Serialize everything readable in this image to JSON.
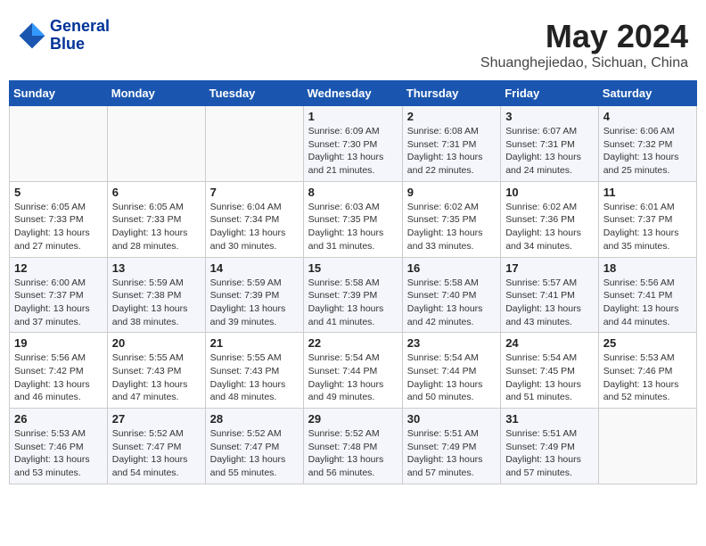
{
  "header": {
    "logo_line1": "General",
    "logo_line2": "Blue",
    "title": "May 2024",
    "subtitle": "Shuanghejiedao, Sichuan, China"
  },
  "weekdays": [
    "Sunday",
    "Monday",
    "Tuesday",
    "Wednesday",
    "Thursday",
    "Friday",
    "Saturday"
  ],
  "weeks": [
    [
      {
        "day": "",
        "info": ""
      },
      {
        "day": "",
        "info": ""
      },
      {
        "day": "",
        "info": ""
      },
      {
        "day": "1",
        "info": "Sunrise: 6:09 AM\nSunset: 7:30 PM\nDaylight: 13 hours\nand 21 minutes."
      },
      {
        "day": "2",
        "info": "Sunrise: 6:08 AM\nSunset: 7:31 PM\nDaylight: 13 hours\nand 22 minutes."
      },
      {
        "day": "3",
        "info": "Sunrise: 6:07 AM\nSunset: 7:31 PM\nDaylight: 13 hours\nand 24 minutes."
      },
      {
        "day": "4",
        "info": "Sunrise: 6:06 AM\nSunset: 7:32 PM\nDaylight: 13 hours\nand 25 minutes."
      }
    ],
    [
      {
        "day": "5",
        "info": "Sunrise: 6:05 AM\nSunset: 7:33 PM\nDaylight: 13 hours\nand 27 minutes."
      },
      {
        "day": "6",
        "info": "Sunrise: 6:05 AM\nSunset: 7:33 PM\nDaylight: 13 hours\nand 28 minutes."
      },
      {
        "day": "7",
        "info": "Sunrise: 6:04 AM\nSunset: 7:34 PM\nDaylight: 13 hours\nand 30 minutes."
      },
      {
        "day": "8",
        "info": "Sunrise: 6:03 AM\nSunset: 7:35 PM\nDaylight: 13 hours\nand 31 minutes."
      },
      {
        "day": "9",
        "info": "Sunrise: 6:02 AM\nSunset: 7:35 PM\nDaylight: 13 hours\nand 33 minutes."
      },
      {
        "day": "10",
        "info": "Sunrise: 6:02 AM\nSunset: 7:36 PM\nDaylight: 13 hours\nand 34 minutes."
      },
      {
        "day": "11",
        "info": "Sunrise: 6:01 AM\nSunset: 7:37 PM\nDaylight: 13 hours\nand 35 minutes."
      }
    ],
    [
      {
        "day": "12",
        "info": "Sunrise: 6:00 AM\nSunset: 7:37 PM\nDaylight: 13 hours\nand 37 minutes."
      },
      {
        "day": "13",
        "info": "Sunrise: 5:59 AM\nSunset: 7:38 PM\nDaylight: 13 hours\nand 38 minutes."
      },
      {
        "day": "14",
        "info": "Sunrise: 5:59 AM\nSunset: 7:39 PM\nDaylight: 13 hours\nand 39 minutes."
      },
      {
        "day": "15",
        "info": "Sunrise: 5:58 AM\nSunset: 7:39 PM\nDaylight: 13 hours\nand 41 minutes."
      },
      {
        "day": "16",
        "info": "Sunrise: 5:58 AM\nSunset: 7:40 PM\nDaylight: 13 hours\nand 42 minutes."
      },
      {
        "day": "17",
        "info": "Sunrise: 5:57 AM\nSunset: 7:41 PM\nDaylight: 13 hours\nand 43 minutes."
      },
      {
        "day": "18",
        "info": "Sunrise: 5:56 AM\nSunset: 7:41 PM\nDaylight: 13 hours\nand 44 minutes."
      }
    ],
    [
      {
        "day": "19",
        "info": "Sunrise: 5:56 AM\nSunset: 7:42 PM\nDaylight: 13 hours\nand 46 minutes."
      },
      {
        "day": "20",
        "info": "Sunrise: 5:55 AM\nSunset: 7:43 PM\nDaylight: 13 hours\nand 47 minutes."
      },
      {
        "day": "21",
        "info": "Sunrise: 5:55 AM\nSunset: 7:43 PM\nDaylight: 13 hours\nand 48 minutes."
      },
      {
        "day": "22",
        "info": "Sunrise: 5:54 AM\nSunset: 7:44 PM\nDaylight: 13 hours\nand 49 minutes."
      },
      {
        "day": "23",
        "info": "Sunrise: 5:54 AM\nSunset: 7:44 PM\nDaylight: 13 hours\nand 50 minutes."
      },
      {
        "day": "24",
        "info": "Sunrise: 5:54 AM\nSunset: 7:45 PM\nDaylight: 13 hours\nand 51 minutes."
      },
      {
        "day": "25",
        "info": "Sunrise: 5:53 AM\nSunset: 7:46 PM\nDaylight: 13 hours\nand 52 minutes."
      }
    ],
    [
      {
        "day": "26",
        "info": "Sunrise: 5:53 AM\nSunset: 7:46 PM\nDaylight: 13 hours\nand 53 minutes."
      },
      {
        "day": "27",
        "info": "Sunrise: 5:52 AM\nSunset: 7:47 PM\nDaylight: 13 hours\nand 54 minutes."
      },
      {
        "day": "28",
        "info": "Sunrise: 5:52 AM\nSunset: 7:47 PM\nDaylight: 13 hours\nand 55 minutes."
      },
      {
        "day": "29",
        "info": "Sunrise: 5:52 AM\nSunset: 7:48 PM\nDaylight: 13 hours\nand 56 minutes."
      },
      {
        "day": "30",
        "info": "Sunrise: 5:51 AM\nSunset: 7:49 PM\nDaylight: 13 hours\nand 57 minutes."
      },
      {
        "day": "31",
        "info": "Sunrise: 5:51 AM\nSunset: 7:49 PM\nDaylight: 13 hours\nand 57 minutes."
      },
      {
        "day": "",
        "info": ""
      }
    ]
  ]
}
